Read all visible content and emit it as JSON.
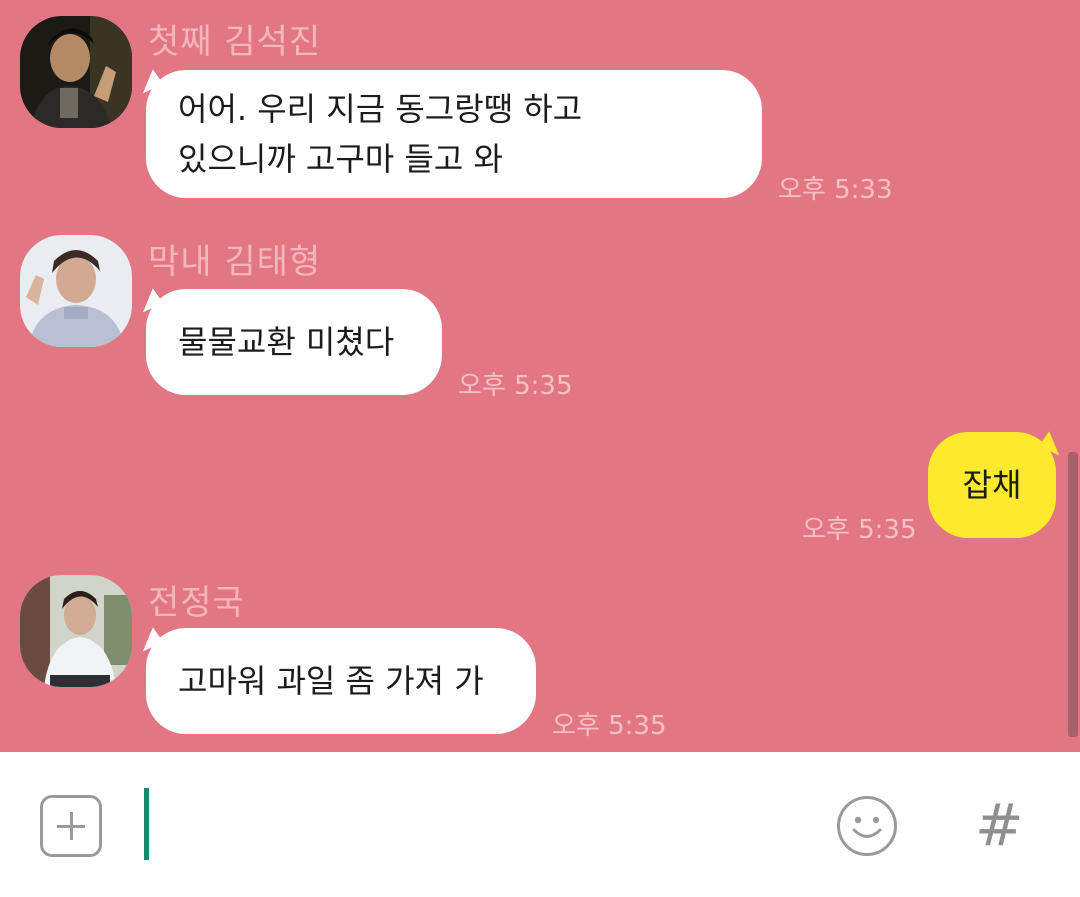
{
  "messages": [
    {
      "sender": "첫째 김석진",
      "lines": [
        "어어. 우리 지금 동그랑땡 하고",
        "있으니까 고구마 들고 와"
      ],
      "time": "오후 5:33",
      "outgoing": false
    },
    {
      "sender": "막내 김태형",
      "lines": [
        "물물교환 미쳤다"
      ],
      "time": "오후 5:35",
      "outgoing": false
    },
    {
      "lines": [
        "잡채"
      ],
      "time": "오후 5:35",
      "outgoing": true
    },
    {
      "sender": "전정국",
      "lines": [
        "고마워 과일 좀 가져 가"
      ],
      "time": "오후 5:35",
      "outgoing": false
    }
  ],
  "input": {
    "value": "",
    "hash_label": "#",
    "add_icon": "plus-square-icon",
    "emoji_icon": "smiley-icon"
  },
  "colors": {
    "background": "#e27783",
    "incoming_bubble": "#ffffff",
    "outgoing_bubble": "#fde92e",
    "sender_text": "#f4b6bd",
    "cursor": "#1a8b73"
  }
}
